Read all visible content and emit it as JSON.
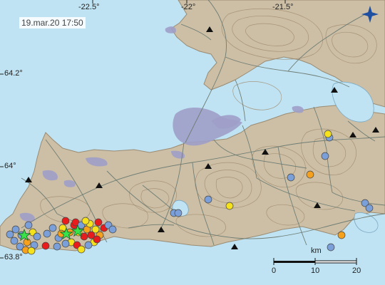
{
  "timestamp": "19.mar.20  17:50",
  "longitude_labels": [
    "-22.5°",
    "-22°",
    "-21.5°"
  ],
  "latitude_labels": [
    "64.2°",
    "64°",
    "63.8°"
  ],
  "scale_bar": {
    "unit": "km",
    "ticks": [
      "0",
      "10",
      "20"
    ]
  },
  "colors": {
    "sea": "#bfe3f3",
    "land": "#cdbfa5",
    "lava": "#9e9fc9",
    "quake_recent_red": "#e81c1c",
    "quake_orange": "#f5a11e",
    "quake_yellow": "#f5e11c",
    "quake_blue_old": "#7b9fd8",
    "star": "#39e34a",
    "station": "#111111"
  },
  "icons": [
    "north-compass-icon",
    "earthquake-star-icon",
    "seismic-station-icon"
  ],
  "legend_meaning": {}
}
